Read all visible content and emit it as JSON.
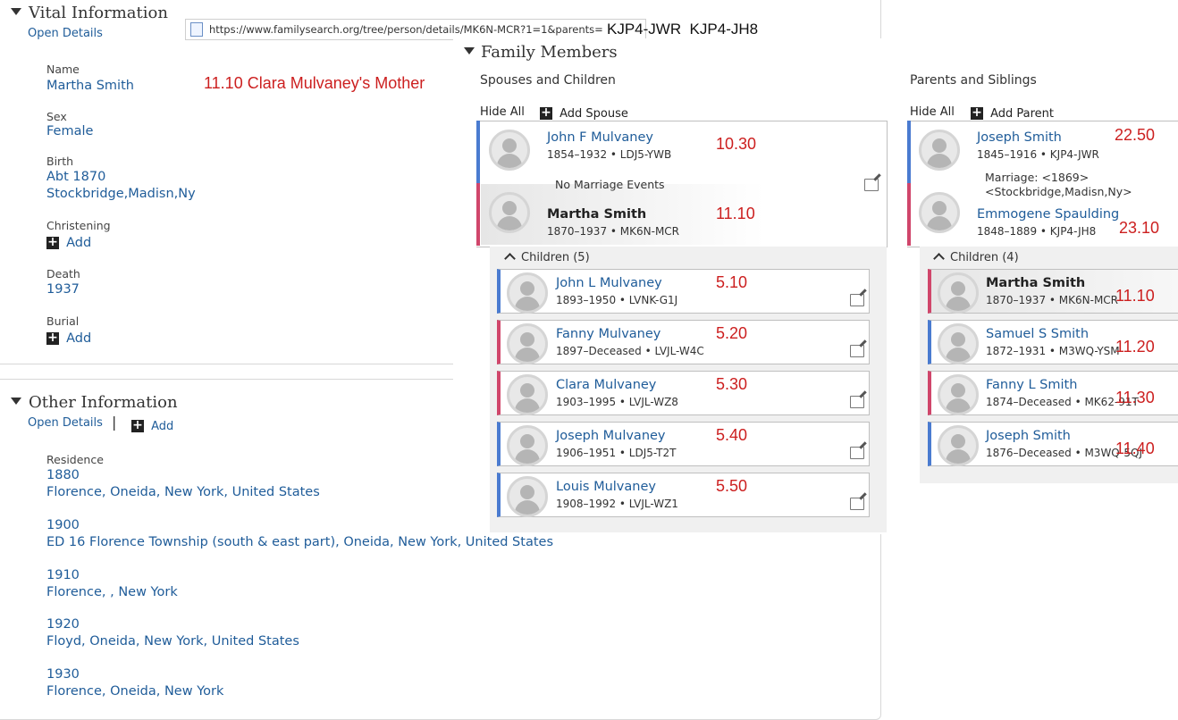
{
  "vital": {
    "title": "Vital Information",
    "open_details": "Open Details",
    "name_label": "Name",
    "name_value": "Martha Smith",
    "sex_label": "Sex",
    "sex_value": "Female",
    "birth_label": "Birth",
    "birth_date": "Abt 1870",
    "birth_place": "Stockbridge,Madisn,Ny",
    "christening_label": "Christening",
    "add_label": "Add",
    "death_label": "Death",
    "death_value": "1937",
    "burial_label": "Burial"
  },
  "url": {
    "text": "https://www.familysearch.org/tree/person/details/MK6N-MCR?1=1&parents=",
    "suffix": "KJP4-JWR  KJP4-JH8"
  },
  "annotation_main": "11.10  Clara Mulvaney's Mother",
  "other": {
    "title": "Other Information",
    "open_details": "Open Details",
    "separator": "|",
    "add_label": "Add",
    "residence_label": "Residence",
    "residences": [
      {
        "year": "1880",
        "place": "Florence, Oneida, New York, United States"
      },
      {
        "year": "1900",
        "place": "ED 16 Florence Township (south & east part), Oneida, New York, United States"
      },
      {
        "year": "1910",
        "place": "Florence, , New York"
      },
      {
        "year": "1920",
        "place": "Floyd, Oneida, New York, United States"
      },
      {
        "year": "1930",
        "place": "Florence, Oneida, New York"
      }
    ]
  },
  "family": {
    "title": "Family Members",
    "spouses_heading": "Spouses and Children",
    "parents_heading": "Parents and Siblings",
    "hide_all": "Hide All",
    "add_spouse": "Add Spouse",
    "add_parent": "Add Parent",
    "spouse": {
      "name": "John F Mulvaney",
      "info": "1854–1932 • LDJ5-YWB",
      "code": "10.30"
    },
    "no_marriage": "No Marriage Events",
    "self": {
      "name": "Martha Smith",
      "info": "1870–1937 • MK6N-MCR",
      "code": "11.10"
    },
    "children_label": "Children (5)",
    "children": [
      {
        "name": "John L Mulvaney",
        "info": "1893–1950 • LVNK-G1J",
        "code": "5.10",
        "sex": "m"
      },
      {
        "name": "Fanny Mulvaney",
        "info": "1897–Deceased • LVJL-W4C",
        "code": "5.20",
        "sex": "f"
      },
      {
        "name": "Clara Mulvaney",
        "info": "1903–1995 • LVJL-WZ8",
        "code": "5.30",
        "sex": "f"
      },
      {
        "name": "Joseph Mulvaney",
        "info": "1906–1951 • LDJ5-T2T",
        "code": "5.40",
        "sex": "m"
      },
      {
        "name": "Louis Mulvaney",
        "info": "1908–1992 • LVJL-WZ1",
        "code": "5.50",
        "sex": "m"
      }
    ],
    "father": {
      "name": "Joseph Smith",
      "info": "1845–1916 • KJP4-JWR",
      "code": "22.50"
    },
    "marriage_line1": "Marriage: <1869>",
    "marriage_line2": "<Stockbridge,Madisn,Ny>",
    "mother": {
      "name": "Emmogene Spaulding",
      "info": "1848–1889 • KJP4-JH8",
      "code": "23.10"
    },
    "siblings_label": "Children (4)",
    "siblings": [
      {
        "name": "Martha Smith",
        "info": "1870–1937 • MK6N-MCR",
        "code": "11.10",
        "sex": "f"
      },
      {
        "name": "Samuel S Smith",
        "info": "1872–1931 • M3WQ-YSM",
        "code": "11.20",
        "sex": "m"
      },
      {
        "name": "Fanny L Smith",
        "info": "1874–Deceased • MK62-91T",
        "code": "11.30",
        "sex": "f"
      },
      {
        "name": "Joseph Smith",
        "info": "1876–Deceased • M3WQ-5QJ",
        "code": "11.40",
        "sex": "m"
      }
    ]
  }
}
